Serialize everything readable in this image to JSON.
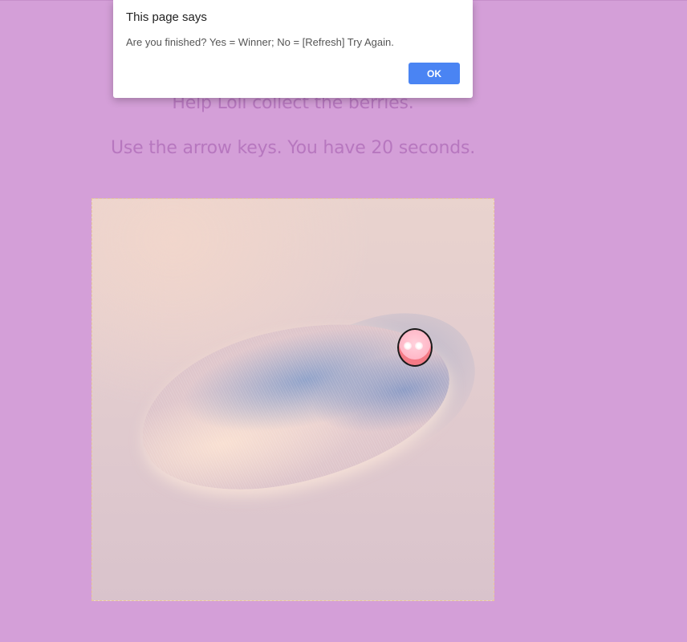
{
  "dialog": {
    "title": "This page says",
    "message": "Are you finished? Yes = Winner; No = [Refresh] Try Again.",
    "ok_label": "OK",
    "ok_color": "#4a84f3"
  },
  "instructions": {
    "line1": "Help Loli collect the berries.",
    "line2": "Use the arrow keys. You have 20 seconds."
  },
  "colors": {
    "page_background": "#d49fd8",
    "instruction_text": "#b777bf",
    "board_border": "#e8c89a",
    "player": "#ffb6c6"
  },
  "game": {
    "player_icon": "loli-character-icon",
    "board_image": "fluffy-fur-island"
  }
}
